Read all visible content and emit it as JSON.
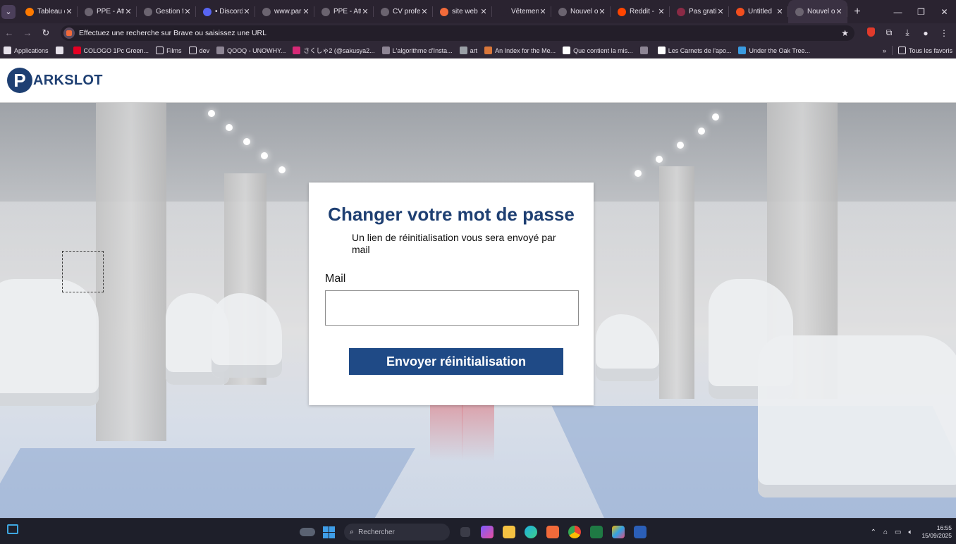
{
  "browser": {
    "tabs": [
      {
        "title": "Tableau d",
        "favicon": "tableau-icon",
        "color": "#ff7a00"
      },
      {
        "title": "PPE - Att",
        "favicon": "globe-icon",
        "color": "#6b6470"
      },
      {
        "title": "Gestion f",
        "favicon": "openai-icon",
        "color": "#6b6470"
      },
      {
        "title": "• Discord",
        "favicon": "discord-icon",
        "color": "#5865f2"
      },
      {
        "title": "www.par",
        "favicon": "globe-icon",
        "color": "#6b6470"
      },
      {
        "title": "PPE - Att",
        "favicon": "globe-icon",
        "color": "#6b6470"
      },
      {
        "title": "CV profe",
        "favicon": "globe-icon",
        "color": "#6b6470"
      },
      {
        "title": "site web",
        "favicon": "brave-icon",
        "color": "#f26a3a"
      },
      {
        "title": "Vêtemen",
        "favicon": "b-icon",
        "color": "#2a2330"
      },
      {
        "title": "Nouvel o",
        "favicon": "globe-icon",
        "color": "#6b6470"
      },
      {
        "title": "Reddit -",
        "favicon": "reddit-icon",
        "color": "#ff4500"
      },
      {
        "title": "Pas grati",
        "favicon": "pinterest-icon",
        "color": "#8a2a45"
      },
      {
        "title": "Untitled",
        "favicon": "figma-icon",
        "color": "#f24e1e"
      },
      {
        "title": "Nouvel o",
        "favicon": "globe-icon",
        "color": "#6b6470",
        "active": true
      }
    ],
    "tab_close": "✕",
    "new_tab": "+",
    "window_controls": {
      "minimize": "—",
      "restore": "❐",
      "close": "✕"
    },
    "address_placeholder": "Effectuez une recherche sur Brave ou saisissez une URL",
    "bookmarks": [
      {
        "label": "Applications",
        "icon": "apps-grid-icon"
      },
      {
        "label": "",
        "icon": "apps-grid-icon"
      },
      {
        "label": "COLOGO 1Pc Green...",
        "icon": "pinterest-icon"
      },
      {
        "label": "Films",
        "icon": "folder-icon"
      },
      {
        "label": "dev",
        "icon": "folder-icon"
      },
      {
        "label": "QOOQ - UNOWHY...",
        "icon": "globe-icon"
      },
      {
        "label": "さくしゃ2 (@sakusya2...",
        "icon": "instagram-icon"
      },
      {
        "label": "L'algorithme d'Insta...",
        "icon": "globe-icon"
      },
      {
        "label": "art",
        "icon": "image-icon"
      },
      {
        "label": "An Index for the Me...",
        "icon": "bookmark-icon"
      },
      {
        "label": "Que contient la mis...",
        "icon": "c-icon"
      },
      {
        "label": "",
        "icon": "globe-icon"
      },
      {
        "label": "Les Carnets de l'apo...",
        "icon": "w-icon"
      },
      {
        "label": "Under the Oak Tree...",
        "icon": "window-icon"
      }
    ],
    "bookmarks_overflow": "»",
    "all_bookmarks": "Tous les favoris"
  },
  "site": {
    "logo_letter": "P",
    "logo_text": "ARKSLOT",
    "brand_color": "#1e3f72"
  },
  "reset_form": {
    "title": "Changer votre mot de passe",
    "subtitle": "Un lien de réinitialisation vous sera envoyé par mail",
    "mail_label": "Mail",
    "mail_value": "",
    "submit_label": "Envoyer réinitialisation",
    "button_color": "#1f4a86"
  },
  "taskbar": {
    "search_placeholder": "Rechercher",
    "time": "16:55",
    "date": "15/09/2025"
  }
}
